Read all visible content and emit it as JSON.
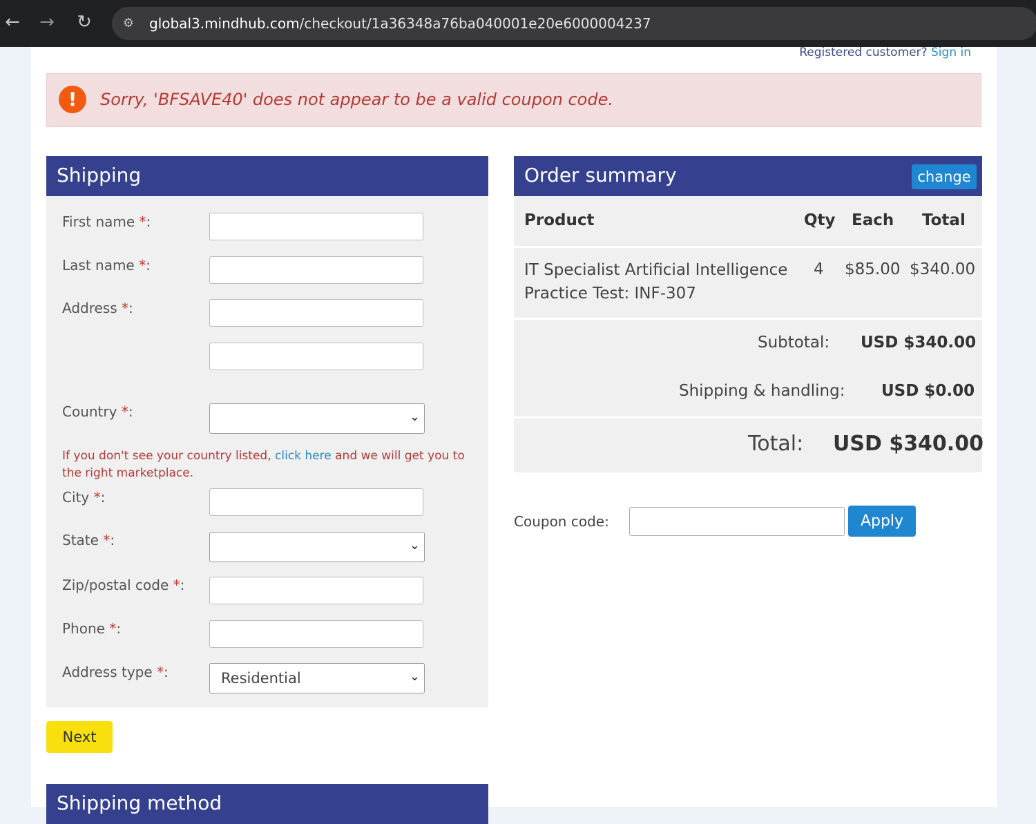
{
  "browser": {
    "url_host": "global3.mindhub.com",
    "url_path": "/checkout/1a36348a76ba040001e20e6000004237"
  },
  "header": {
    "registered_text": "Registered customer?",
    "sign_in_label": "Sign in"
  },
  "alert": {
    "message": "Sorry, 'BFSAVE40' does not appear to be a valid coupon code."
  },
  "shipping": {
    "title": "Shipping",
    "fields": {
      "first_name": "First name",
      "last_name": "Last name",
      "address": "Address",
      "country": "Country",
      "city": "City",
      "state": "State",
      "zip": "Zip/postal code",
      "phone": "Phone",
      "address_type": "Address type"
    },
    "required_marker": "*",
    "address_type_value": "Residential",
    "country_note_before": "If you don't see your country listed,",
    "country_note_link": "click here",
    "country_note_after": "and we will get you to the right marketplace.",
    "next_label": "Next"
  },
  "shipping_method": {
    "title": "Shipping method"
  },
  "order_summary": {
    "title": "Order summary",
    "change_label": "change",
    "columns": {
      "product": "Product",
      "qty": "Qty",
      "each": "Each",
      "total": "Total"
    },
    "items": [
      {
        "product_line1": "IT Specialist Artificial Intelligence",
        "product_line2": "Practice Test: INF-307",
        "qty": "4",
        "each": "$85.00",
        "total": "$340.00"
      }
    ],
    "subtotal_label": "Subtotal:",
    "subtotal_value": "USD $340.00",
    "shipping_label": "Shipping & handling:",
    "shipping_value": "USD $0.00",
    "total_label": "Total:",
    "total_value": "USD $340.00"
  },
  "coupon": {
    "label": "Coupon code:",
    "value": "",
    "apply_label": "Apply"
  },
  "colors": {
    "header_blue": "#35408f",
    "button_blue": "#1f86d1",
    "next_yellow": "#f8e00f",
    "alert_bg": "#f2dede",
    "alert_icon": "#f25a12"
  }
}
